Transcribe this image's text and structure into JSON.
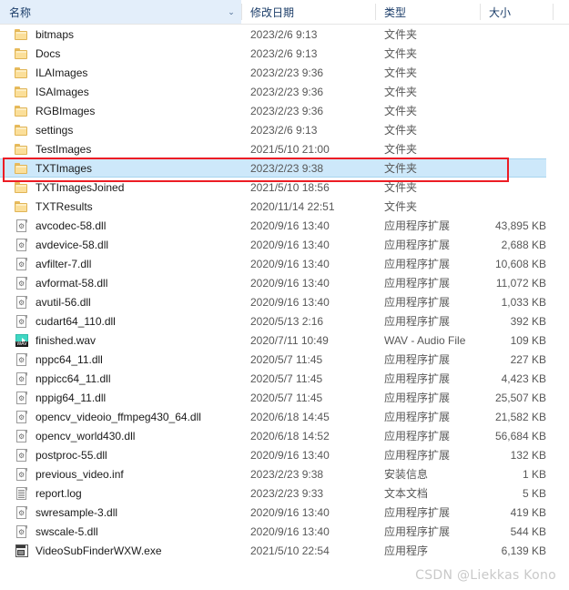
{
  "header": {
    "columns": [
      {
        "label": "名称",
        "key": "name"
      },
      {
        "label": "修改日期",
        "key": "date"
      },
      {
        "label": "类型",
        "key": "type"
      },
      {
        "label": "大小",
        "key": "size"
      }
    ],
    "sort_indicator": "⌄",
    "active_column": "名称"
  },
  "colors": {
    "selection_bg": "#cde8fa",
    "selection_border": "#a8d4ef",
    "header_active_bg": "#e3eefa",
    "header_text": "#1b3d69",
    "annotation": "#ec1c24",
    "folder_icon": "#fbdf9a",
    "wav_icon": "#3fd7c3",
    "watermark_text": "#c9c9c9"
  },
  "rows": [
    {
      "icon": "folder-icon",
      "name": "bitmaps",
      "date": "2023/2/6 9:13",
      "type": "文件夹",
      "size": "",
      "selected": false
    },
    {
      "icon": "folder-icon",
      "name": "Docs",
      "date": "2023/2/6 9:13",
      "type": "文件夹",
      "size": "",
      "selected": false
    },
    {
      "icon": "folder-icon",
      "name": "ILAImages",
      "date": "2023/2/23 9:36",
      "type": "文件夹",
      "size": "",
      "selected": false
    },
    {
      "icon": "folder-icon",
      "name": "ISAImages",
      "date": "2023/2/23 9:36",
      "type": "文件夹",
      "size": "",
      "selected": false
    },
    {
      "icon": "folder-icon",
      "name": "RGBImages",
      "date": "2023/2/23 9:36",
      "type": "文件夹",
      "size": "",
      "selected": false
    },
    {
      "icon": "folder-icon",
      "name": "settings",
      "date": "2023/2/6 9:13",
      "type": "文件夹",
      "size": "",
      "selected": false
    },
    {
      "icon": "folder-icon",
      "name": "TestImages",
      "date": "2021/5/10 21:00",
      "type": "文件夹",
      "size": "",
      "selected": false
    },
    {
      "icon": "folder-icon",
      "name": "TXTImages",
      "date": "2023/2/23 9:38",
      "type": "文件夹",
      "size": "",
      "selected": true
    },
    {
      "icon": "folder-icon",
      "name": "TXTImagesJoined",
      "date": "2021/5/10 18:56",
      "type": "文件夹",
      "size": "",
      "selected": false
    },
    {
      "icon": "folder-icon",
      "name": "TXTResults",
      "date": "2020/11/14 22:51",
      "type": "文件夹",
      "size": "",
      "selected": false
    },
    {
      "icon": "dll-icon",
      "name": "avcodec-58.dll",
      "date": "2020/9/16 13:40",
      "type": "应用程序扩展",
      "size": "43,895 KB",
      "selected": false
    },
    {
      "icon": "dll-icon",
      "name": "avdevice-58.dll",
      "date": "2020/9/16 13:40",
      "type": "应用程序扩展",
      "size": "2,688 KB",
      "selected": false
    },
    {
      "icon": "dll-icon",
      "name": "avfilter-7.dll",
      "date": "2020/9/16 13:40",
      "type": "应用程序扩展",
      "size": "10,608 KB",
      "selected": false
    },
    {
      "icon": "dll-icon",
      "name": "avformat-58.dll",
      "date": "2020/9/16 13:40",
      "type": "应用程序扩展",
      "size": "11,072 KB",
      "selected": false
    },
    {
      "icon": "dll-icon",
      "name": "avutil-56.dll",
      "date": "2020/9/16 13:40",
      "type": "应用程序扩展",
      "size": "1,033 KB",
      "selected": false
    },
    {
      "icon": "dll-icon",
      "name": "cudart64_110.dll",
      "date": "2020/5/13 2:16",
      "type": "应用程序扩展",
      "size": "392 KB",
      "selected": false
    },
    {
      "icon": "wav-icon",
      "name": "finished.wav",
      "date": "2020/7/11 10:49",
      "type": "WAV - Audio File",
      "size": "109 KB",
      "selected": false
    },
    {
      "icon": "dll-icon",
      "name": "nppc64_11.dll",
      "date": "2020/5/7 11:45",
      "type": "应用程序扩展",
      "size": "227 KB",
      "selected": false
    },
    {
      "icon": "dll-icon",
      "name": "nppicc64_11.dll",
      "date": "2020/5/7 11:45",
      "type": "应用程序扩展",
      "size": "4,423 KB",
      "selected": false
    },
    {
      "icon": "dll-icon",
      "name": "nppig64_11.dll",
      "date": "2020/5/7 11:45",
      "type": "应用程序扩展",
      "size": "25,507 KB",
      "selected": false
    },
    {
      "icon": "dll-icon",
      "name": "opencv_videoio_ffmpeg430_64.dll",
      "date": "2020/6/18 14:45",
      "type": "应用程序扩展",
      "size": "21,582 KB",
      "selected": false
    },
    {
      "icon": "dll-icon",
      "name": "opencv_world430.dll",
      "date": "2020/6/18 14:52",
      "type": "应用程序扩展",
      "size": "56,684 KB",
      "selected": false
    },
    {
      "icon": "dll-icon",
      "name": "postproc-55.dll",
      "date": "2020/9/16 13:40",
      "type": "应用程序扩展",
      "size": "132 KB",
      "selected": false
    },
    {
      "icon": "inf-icon",
      "name": "previous_video.inf",
      "date": "2023/2/23 9:38",
      "type": "安装信息",
      "size": "1 KB",
      "selected": false
    },
    {
      "icon": "log-icon",
      "name": "report.log",
      "date": "2023/2/23 9:33",
      "type": "文本文档",
      "size": "5 KB",
      "selected": false
    },
    {
      "icon": "dll-icon",
      "name": "swresample-3.dll",
      "date": "2020/9/16 13:40",
      "type": "应用程序扩展",
      "size": "419 KB",
      "selected": false
    },
    {
      "icon": "dll-icon",
      "name": "swscale-5.dll",
      "date": "2020/9/16 13:40",
      "type": "应用程序扩展",
      "size": "544 KB",
      "selected": false
    },
    {
      "icon": "exe-icon",
      "name": "VideoSubFinderWXW.exe",
      "date": "2021/5/10 22:54",
      "type": "应用程序",
      "size": "6,139 KB",
      "selected": false
    }
  ],
  "annotation": {
    "target_row": "TXTImages",
    "shape": "rectangle"
  },
  "watermark": {
    "text": "CSDN @Liekkas Kono"
  },
  "wav_badge": "WAV"
}
